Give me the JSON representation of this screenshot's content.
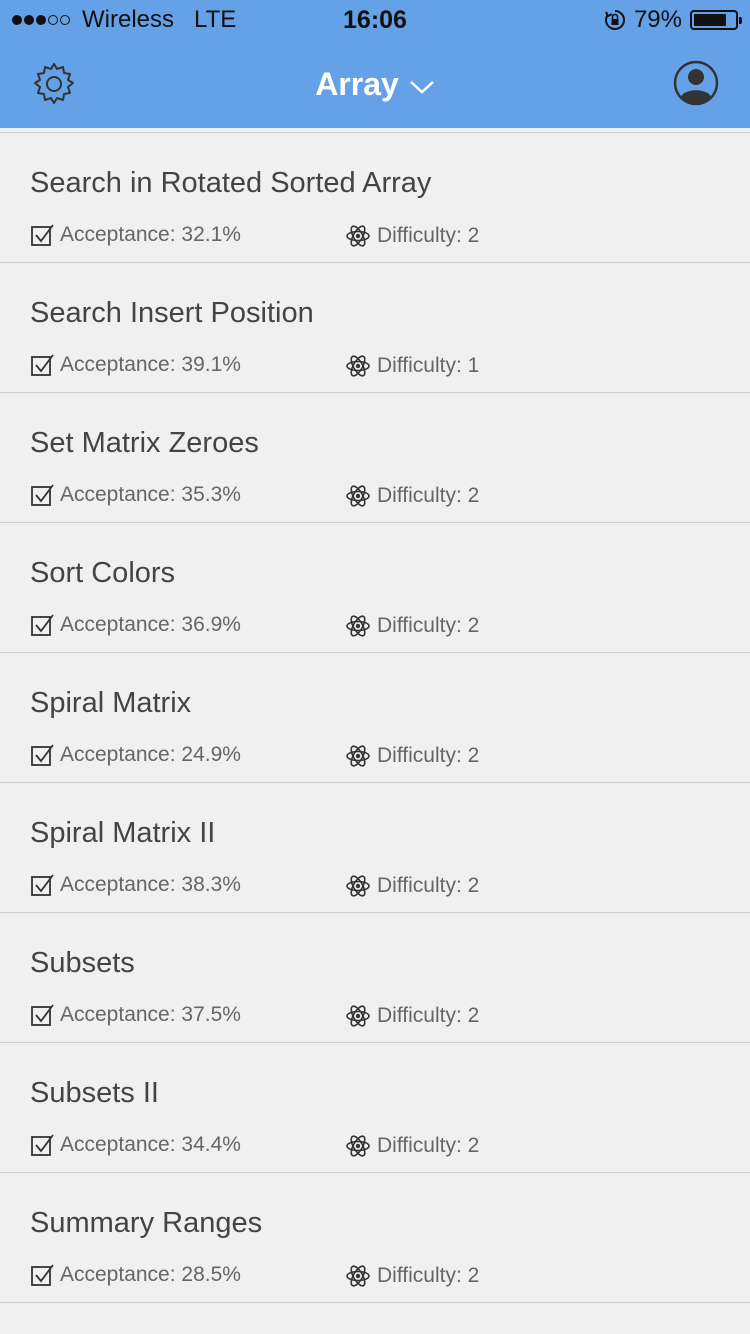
{
  "status_bar": {
    "carrier": "Wireless",
    "network": "LTE",
    "time": "16:06",
    "battery": "79%",
    "battery_level": 0.79
  },
  "navbar": {
    "title": "Array"
  },
  "colors": {
    "header": "#64a1e6",
    "background": "#f0f0f0"
  },
  "problems": [
    {
      "title": "Search in Rotated Sorted Array",
      "acceptance": "Acceptance: 32.1%",
      "difficulty": "Difficulty: 2"
    },
    {
      "title": "Search Insert Position",
      "acceptance": "Acceptance: 39.1%",
      "difficulty": "Difficulty: 1"
    },
    {
      "title": "Set Matrix Zeroes",
      "acceptance": "Acceptance: 35.3%",
      "difficulty": "Difficulty: 2"
    },
    {
      "title": "Sort Colors",
      "acceptance": "Acceptance: 36.9%",
      "difficulty": "Difficulty: 2"
    },
    {
      "title": "Spiral Matrix",
      "acceptance": "Acceptance: 24.9%",
      "difficulty": "Difficulty: 2"
    },
    {
      "title": "Spiral Matrix II",
      "acceptance": "Acceptance: 38.3%",
      "difficulty": "Difficulty: 2"
    },
    {
      "title": "Subsets",
      "acceptance": "Acceptance: 37.5%",
      "difficulty": "Difficulty: 2"
    },
    {
      "title": "Subsets II",
      "acceptance": "Acceptance: 34.4%",
      "difficulty": "Difficulty: 2"
    },
    {
      "title": "Summary Ranges",
      "acceptance": "Acceptance: 28.5%",
      "difficulty": "Difficulty: 2"
    }
  ]
}
